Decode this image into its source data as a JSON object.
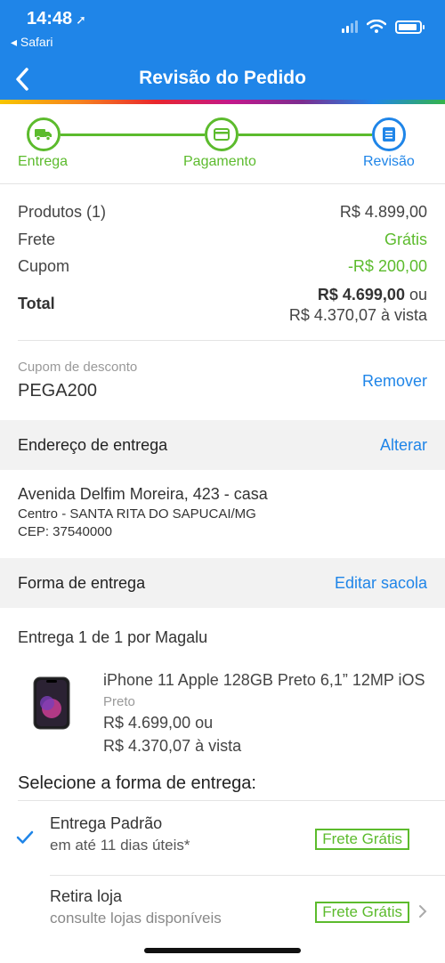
{
  "status_bar": {
    "time": "14:48",
    "back_app": "◂ Safari"
  },
  "header": {
    "title": "Revisão do Pedido"
  },
  "stepper": {
    "steps": [
      {
        "label": "Entrega"
      },
      {
        "label": "Pagamento"
      },
      {
        "label": "Revisão"
      }
    ]
  },
  "summary": {
    "products_label": "Produtos (1)",
    "products_value": "R$ 4.899,00",
    "shipping_label": "Frete",
    "shipping_value": "Grátis",
    "coupon_label": "Cupom",
    "coupon_value": "-R$ 200,00",
    "total_label": "Total",
    "total_value": "R$ 4.699,00",
    "total_or": "ou",
    "total_cash": "R$ 4.370,07 à vista"
  },
  "coupon": {
    "label": "Cupom de desconto",
    "code": "PEGA200",
    "remove_label": "Remover"
  },
  "address_section": {
    "title": "Endereço de entrega",
    "action": "Alterar",
    "line1": "Avenida Delfim Moreira, 423 - casa",
    "line2": "Centro - SANTA RITA DO SAPUCAI/MG",
    "line3": "CEP: 37540000"
  },
  "delivery_section": {
    "title": "Forma de entrega",
    "action": "Editar sacola"
  },
  "delivery": {
    "title": "Entrega 1 de 1 por Magalu"
  },
  "product": {
    "name": "iPhone 11 Apple 128GB Preto 6,1” 12MP iOS",
    "color": "Preto",
    "price": "R$ 4.699,00 ou",
    "cash_price": "R$ 4.370,07 à vista"
  },
  "shipping_options": {
    "title": "Selecione a forma de entrega:",
    "options": [
      {
        "name": "Entrega Padrão",
        "detail": "em até 11 dias úteis*",
        "badge": "Frete Grátis",
        "selected": true
      },
      {
        "name": "Retira loja",
        "detail": "consulte lojas disponíveis",
        "badge": "Frete Grátis",
        "selected": false
      }
    ]
  },
  "colors": {
    "brand_blue": "#1f85e8",
    "green": "#5cbb2d"
  }
}
